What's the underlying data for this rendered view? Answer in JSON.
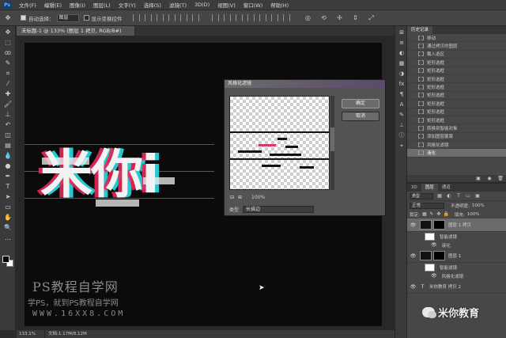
{
  "app": {
    "logo": "Ps",
    "menu": [
      "文件(F)",
      "编辑(E)",
      "图像(I)",
      "图层(L)",
      "文字(Y)",
      "选择(S)",
      "滤镜(T)",
      "3D(D)",
      "视图(V)",
      "窗口(W)",
      "帮助(H)"
    ]
  },
  "options": {
    "auto_select_label": "自动选择：",
    "auto_select_value": "图层",
    "show_transform_label": "显示变换控件"
  },
  "document": {
    "tab_title": "未标题-1 @ 133% (图层 1 拷贝, RGB/8#)",
    "zoom": "133.1%",
    "doc_info": "文档:1.17M/8.12M"
  },
  "canvas": {
    "glitch_text": "米你i",
    "watermark_title": "PS教程自学网",
    "watermark_subtitle": "学PS，就到PS教程自学网",
    "watermark_url": "WWW.16XX8.COM"
  },
  "dialog": {
    "title": "风格化滤镜",
    "ok": "确定",
    "cancel": "取消",
    "zoom_value": "100%",
    "type_label": "类型",
    "type_value": "长描边"
  },
  "history": {
    "tabs": [
      "历史记录"
    ],
    "items": [
      {
        "label": "移动",
        "active": false
      },
      {
        "label": "通过拷贝的图层",
        "active": false
      },
      {
        "label": "载入选区",
        "active": false
      },
      {
        "label": "矩形选框",
        "active": false
      },
      {
        "label": "矩形选框",
        "active": false
      },
      {
        "label": "矩形选框",
        "active": false
      },
      {
        "label": "矩形选框",
        "active": false
      },
      {
        "label": "矩形选框",
        "active": false
      },
      {
        "label": "矩形选框",
        "active": false
      },
      {
        "label": "矩形选框",
        "active": false
      },
      {
        "label": "矩形选框",
        "active": false
      },
      {
        "label": "转换到智能对象",
        "active": false
      },
      {
        "label": "添加图层蒙版",
        "active": false
      },
      {
        "label": "风格化滤镜",
        "active": false
      },
      {
        "label": "液化",
        "active": true
      }
    ]
  },
  "layers": {
    "tabs": [
      "3D",
      "图层",
      "通道"
    ],
    "filter_value": "类型",
    "blend_mode": "正常",
    "opacity_label": "不透明度:",
    "opacity_value": "100%",
    "lock_label": "锁定:",
    "fill_label": "填充:",
    "fill_value": "100%",
    "rows": [
      {
        "name": "图层 1 拷贝",
        "selected": true
      },
      {
        "name": "图层 1",
        "selected": false
      }
    ],
    "sub_rows": [
      "智能滤镜",
      "液化",
      "智能滤镜",
      "风格化滤镜"
    ],
    "text_layer": "米你教育 拷贝 2"
  },
  "logo_watermark": "米你教育"
}
